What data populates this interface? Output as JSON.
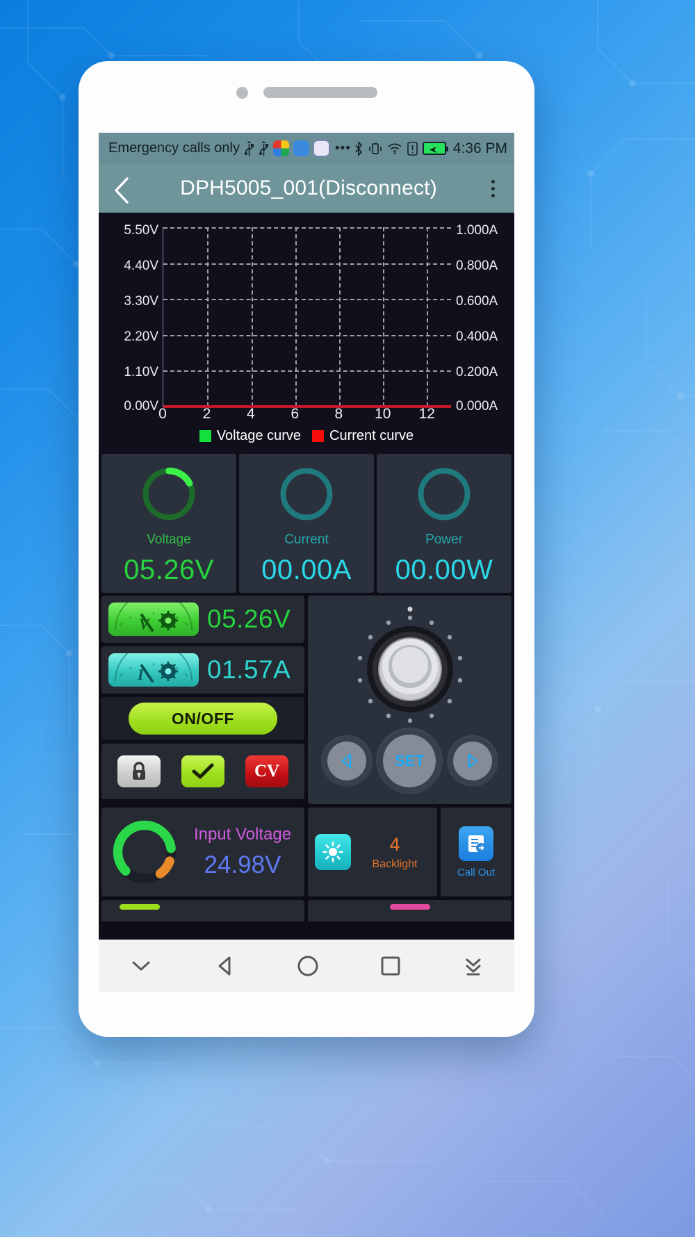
{
  "statusbar": {
    "carrier": "Emergency calls only",
    "icons": [
      "usb-icon",
      "usb-icon",
      "google-photos-icon",
      "app-blue-icon",
      "music-icon",
      "more-dots-icon"
    ],
    "right_icons": [
      "bluetooth-icon",
      "vibrate-icon",
      "wifi-icon",
      "sim-alert-icon",
      "battery-charging-icon"
    ],
    "time": "4:36 PM"
  },
  "titlebar": {
    "back": "back-icon",
    "title": "DPH5005_001(Disconnect)",
    "menu": "overflow-menu-icon"
  },
  "chart_data": {
    "type": "line",
    "title": "",
    "xlabel": "",
    "ylabel": "",
    "x": [
      0,
      2,
      4,
      6,
      8,
      10,
      12
    ],
    "xticks": [
      "0",
      "2",
      "4",
      "6",
      "8",
      "10",
      "12"
    ],
    "xlim": [
      0,
      13
    ],
    "left_axis": {
      "label": "Voltage",
      "unit": "V",
      "ticks": [
        "0.00V",
        "1.10V",
        "2.20V",
        "3.30V",
        "4.40V",
        "5.50V"
      ],
      "values": [
        0.0,
        1.1,
        2.2,
        3.3,
        4.4,
        5.5
      ],
      "ylim": [
        0,
        5.5
      ]
    },
    "right_axis": {
      "label": "Current",
      "unit": "A",
      "ticks": [
        "0.000A",
        "0.200A",
        "0.400A",
        "0.600A",
        "0.800A",
        "1.000A"
      ],
      "values": [
        0.0,
        0.2,
        0.4,
        0.6,
        0.8,
        1.0
      ],
      "ylim": [
        0,
        1.0
      ]
    },
    "series": [
      {
        "name": "Voltage curve",
        "color": "#14e03c",
        "axis": "left",
        "values": [
          0,
          0,
          0,
          0,
          0,
          0,
          0
        ]
      },
      {
        "name": "Current curve",
        "color": "#f70c0c",
        "axis": "right",
        "values": [
          0,
          0,
          0,
          0,
          0,
          0,
          0
        ]
      }
    ],
    "legend": [
      {
        "label": "Voltage curve",
        "color": "#14e03c"
      },
      {
        "label": "Current curve",
        "color": "#f70c0c"
      }
    ],
    "grid": true,
    "legend_position": "bottom"
  },
  "gauges": [
    {
      "label": "Voltage",
      "value": "05.26V",
      "color": "#27d33f",
      "ring_pct": 17,
      "ring_color": "#3cf04a",
      "track_color": "#1c6b2a"
    },
    {
      "label": "Current",
      "value": "00.00A",
      "color": "#2ad8e8",
      "ring_pct": 0,
      "ring_color": "#2ad8e8",
      "track_color": "#1f7a7e"
    },
    {
      "label": "Power",
      "value": "00.00W",
      "color": "#2ad8e8",
      "ring_pct": 0,
      "ring_color": "#2ad8e8",
      "track_color": "#1f7a7e"
    }
  ],
  "setpoints": [
    {
      "icon": "voltage-meter-icon",
      "value": "05.26V",
      "color": "#27d33f"
    },
    {
      "icon": "current-meter-icon",
      "value": "01.57A",
      "color": "#2fd6d0"
    }
  ],
  "controls": {
    "onoff_label": "ON/OFF",
    "lock_icon": "lock-icon",
    "ok_icon": "check-icon",
    "mode_label": "CV"
  },
  "dial": {
    "left_icon": "triangle-left-icon",
    "set_label": "SET",
    "right_icon": "triangle-right-icon"
  },
  "input_voltage": {
    "title": "Input Voltage",
    "value": "24.98V",
    "ring_pct": 70
  },
  "backlight": {
    "icon": "brightness-icon",
    "value": "4",
    "label": "Backlight"
  },
  "call_out": {
    "icon": "call-out-icon",
    "label": "Call Out"
  },
  "navbar": {
    "items": [
      "chevron-down-icon",
      "back-triangle-icon",
      "home-circle-icon",
      "recents-square-icon",
      "download-icon"
    ]
  }
}
